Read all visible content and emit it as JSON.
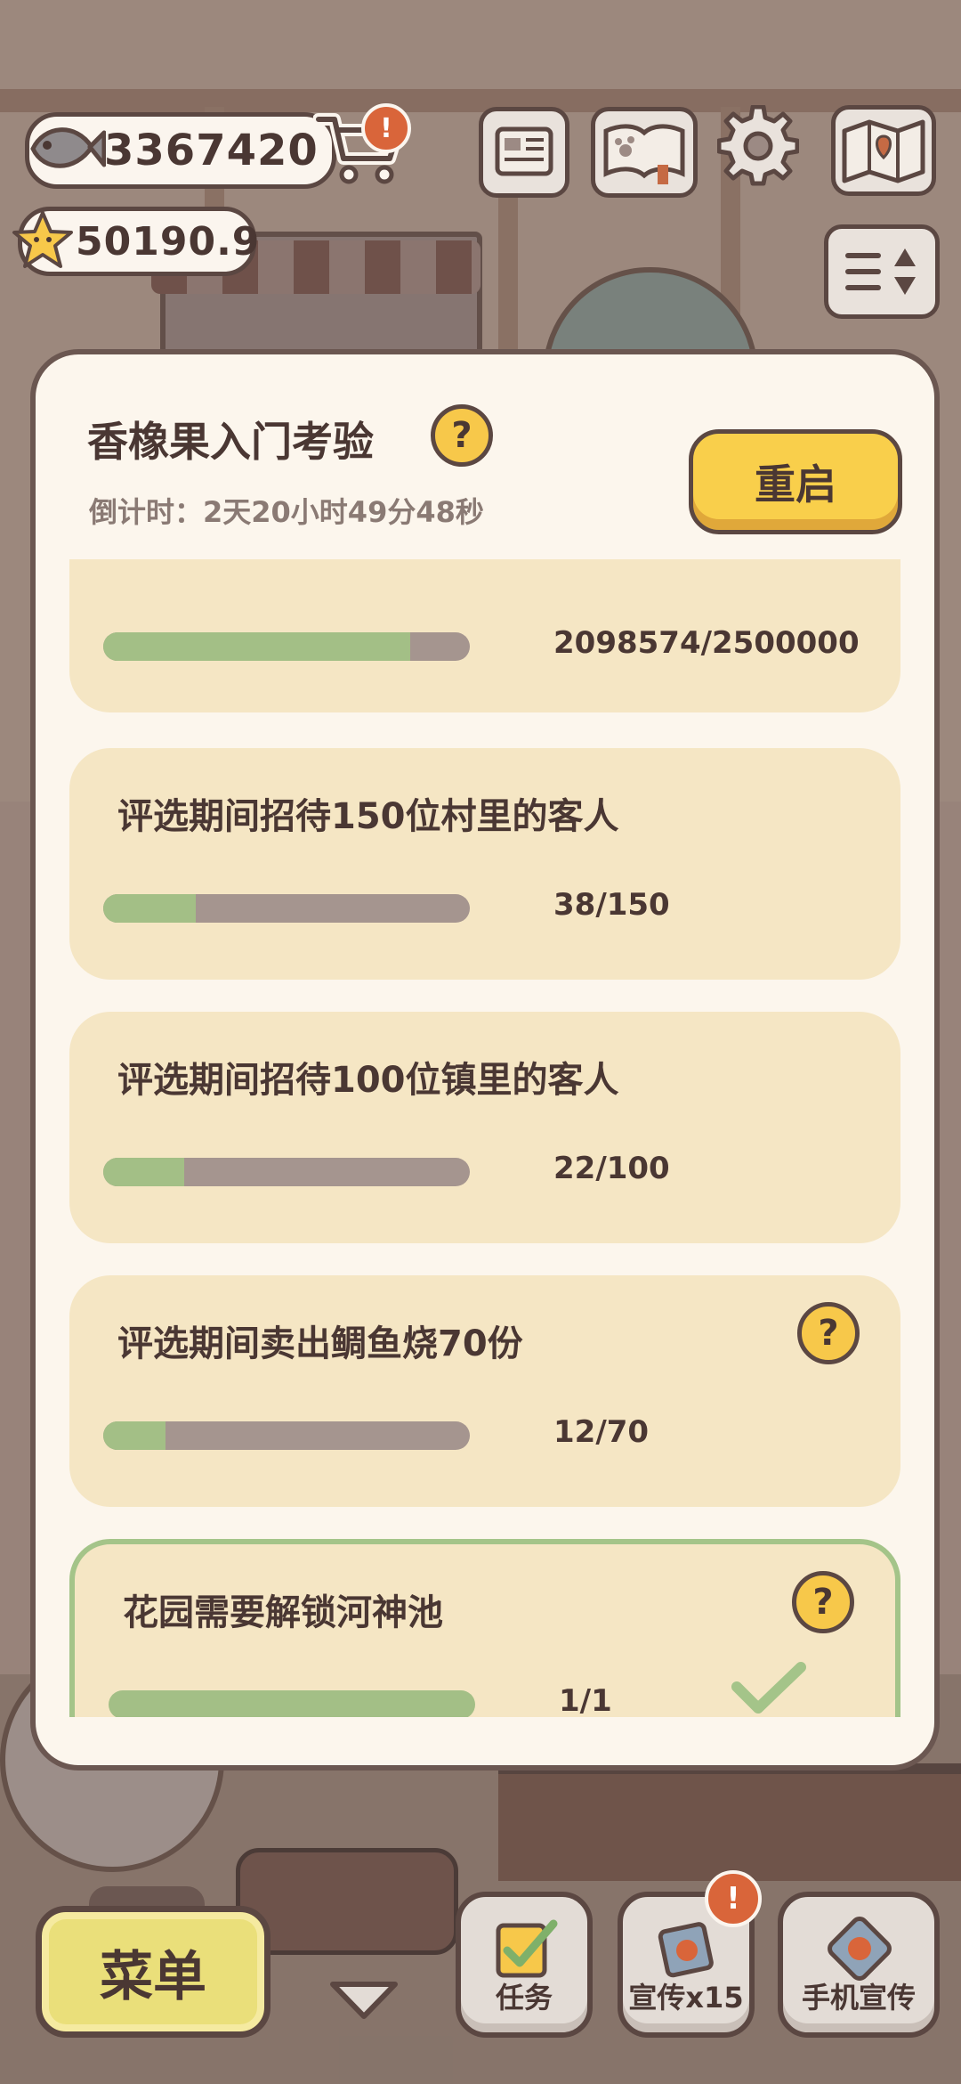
{
  "hud": {
    "fish_value": "3367420",
    "star_value": "50190.9",
    "cart_alert": "!"
  },
  "dialog": {
    "title": "香橡果入门考验",
    "help": "?",
    "countdown": "倒计时：2天20小时49分48秒",
    "restart": "重启"
  },
  "tasks": [
    {
      "label": "",
      "count": "2098574/2500000",
      "progress": 0.837,
      "help": false,
      "done": false
    },
    {
      "label": "评选期间招待150位村里的客人",
      "count": "38/150",
      "progress": 0.253,
      "help": false,
      "done": false
    },
    {
      "label": "评选期间招待100位镇里的客人",
      "count": "22/100",
      "progress": 0.22,
      "help": false,
      "done": false
    },
    {
      "label": "评选期间卖出鲷鱼烧70份",
      "count": "12/70",
      "progress": 0.171,
      "help": true,
      "done": false
    },
    {
      "label": "花园需要解锁河神池",
      "count": "1/1",
      "progress": 1.0,
      "help": true,
      "done": true
    }
  ],
  "bottom": {
    "menu": "菜单",
    "tasks": "任务",
    "promo": "宣传x15",
    "promo_alert": "!",
    "phone_promo": "手机宣传"
  },
  "colors": {
    "progress_fill": "#a3bf86",
    "progress_track": "#a5958f",
    "card": "#f5e6c4",
    "restart_button": "#f9cf4b"
  }
}
